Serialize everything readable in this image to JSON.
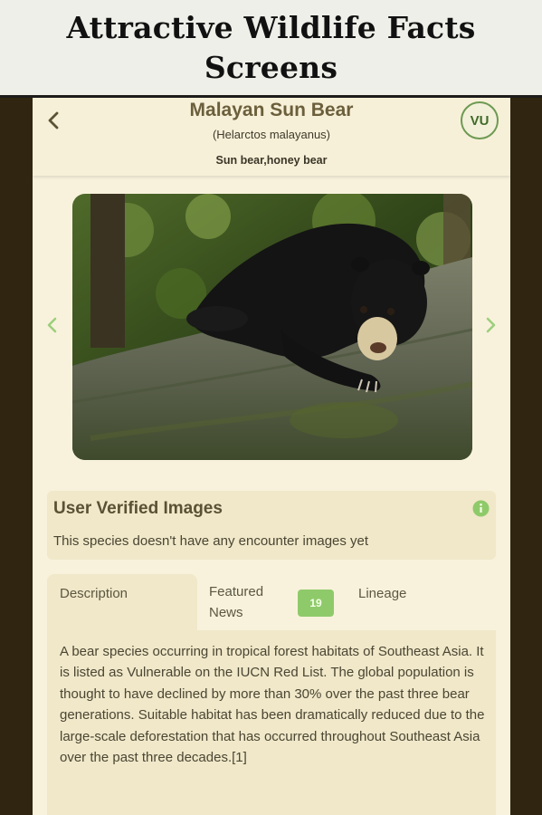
{
  "banner": {
    "line1": "Attractive Wildlife Facts",
    "line2": "Screens"
  },
  "header": {
    "title": "Malayan Sun Bear",
    "scientific_name": "(Helarctos malayanus)",
    "common_names": "Sun bear,honey bear",
    "status_badge": "VU"
  },
  "gallery": {
    "prev_icon": "chevron-left-icon",
    "next_icon": "chevron-right-icon"
  },
  "user_verified": {
    "title": "User Verified Images",
    "message": "This species doesn't have any encounter images yet",
    "info_icon": "info-icon"
  },
  "tabs": {
    "description": "Description",
    "featured_news_line1": "Featured",
    "featured_news_line2": "News",
    "news_count": "19",
    "lineage": "Lineage"
  },
  "description": {
    "text": "A bear species occurring in tropical forest habitats of Southeast Asia. It is listed as Vulnerable on the IUCN Red List. The global population is thought to have declined by more than 30% over the past three bear generations. Suitable habitat has been dramatically reduced due to the large-scale deforestation that has occurred throughout Southeast Asia over the past three decades.[1]"
  },
  "colors": {
    "accent_green": "#8fca6a",
    "badge_border": "#6d9a54",
    "title_color": "#6b5f3c",
    "card_bg": "#f0e8c9",
    "page_bg": "#f8f2dc"
  }
}
